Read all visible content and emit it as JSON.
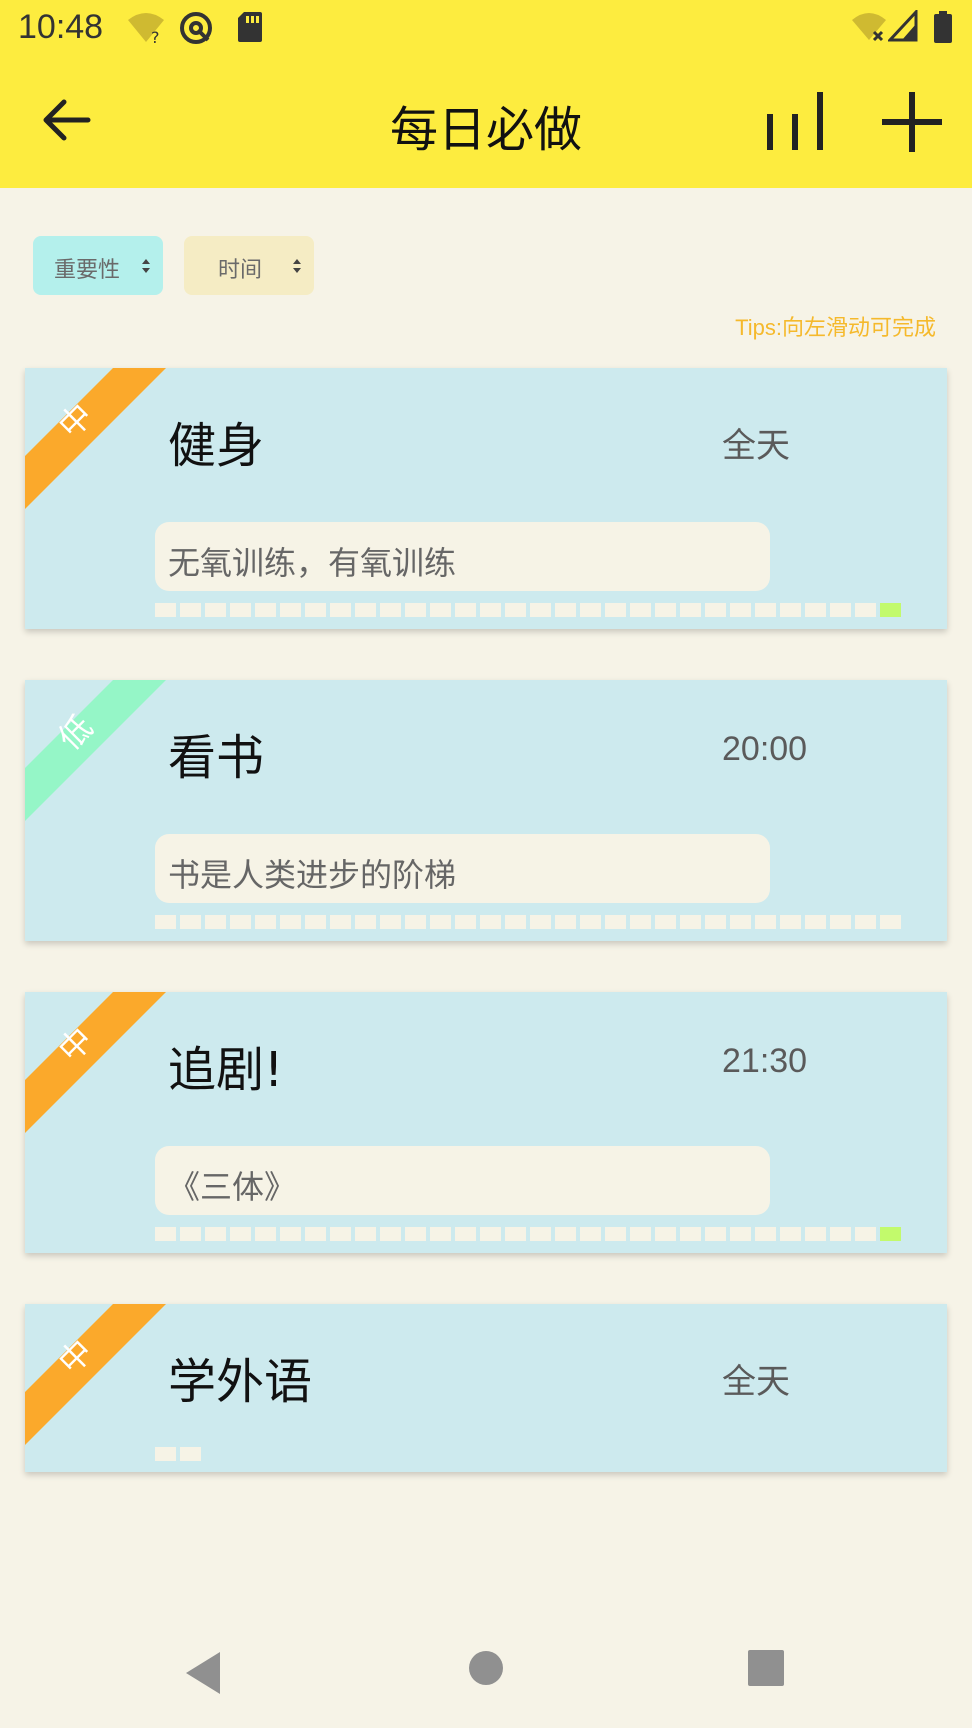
{
  "status_bar": {
    "time": "10:48",
    "icons": [
      "wifi-question-icon",
      "hotspot-icon",
      "sd-card-icon",
      "wifi-off-icon",
      "signal-icon",
      "battery-icon"
    ]
  },
  "app_bar": {
    "title": "每日必做",
    "back_icon": "arrow-left-icon",
    "stats_icon": "bar-chart-icon",
    "add_icon": "plus-icon",
    "color": "#fdec3f"
  },
  "sort": {
    "importance_label": "重要性",
    "time_label": "时间"
  },
  "tips": "Tips:向左滑动可完成",
  "colors": {
    "priority_mid": "#fba92b",
    "priority_low": "#95f6c7",
    "card_bg": "#cdeaee",
    "page_bg": "#f6f3e7",
    "bar_on": "#c2fa6c",
    "bar_off": "#f6f3e6"
  },
  "tasks": [
    {
      "priority": "中",
      "title": "健身",
      "time": "全天",
      "note": "无氧训练，有氧训练",
      "checkin_days": 30,
      "checkin_done": [
        29
      ]
    },
    {
      "priority": "低",
      "title": "看书",
      "time": "20:00",
      "note": "书是人类进步的阶梯",
      "checkin_days": 30,
      "checkin_done": []
    },
    {
      "priority": "中",
      "title": "追剧!",
      "time": "21:30",
      "note": "《三体》",
      "checkin_days": 30,
      "checkin_done": [
        29
      ]
    },
    {
      "priority": "中",
      "title": "学外语",
      "time": "全天",
      "note": "",
      "checkin_days": 2,
      "checkin_done": []
    }
  ],
  "nav_bar": {
    "back_icon": "triangle-back-icon",
    "home_icon": "circle-home-icon",
    "recents_icon": "square-recents-icon"
  }
}
